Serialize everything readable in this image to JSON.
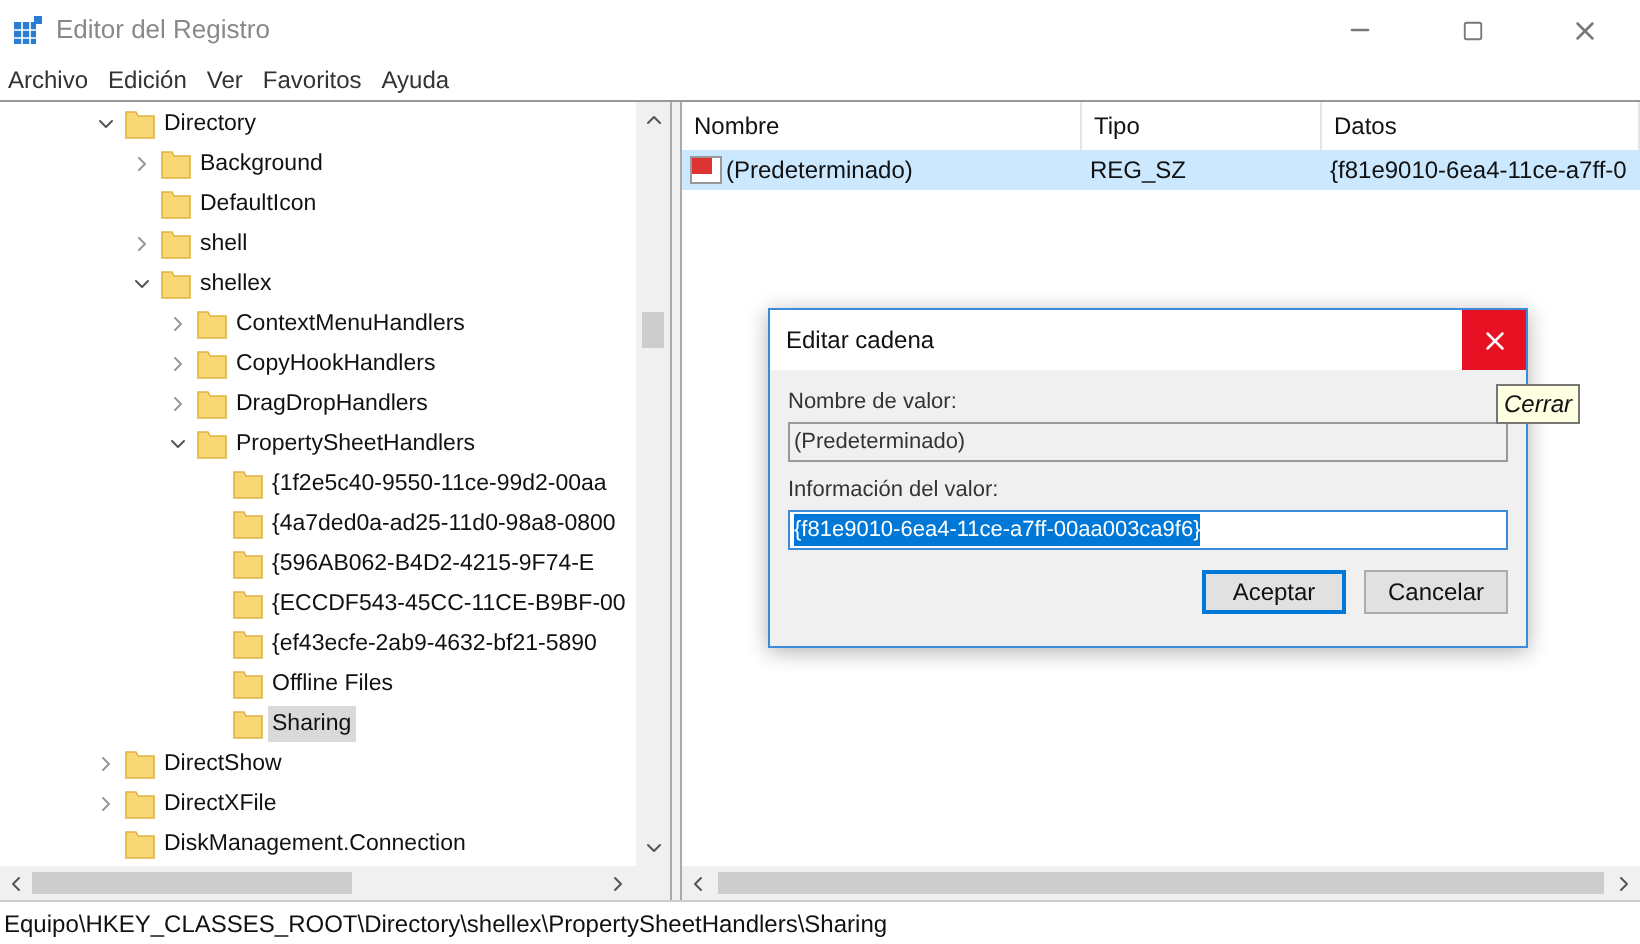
{
  "window": {
    "title": "Editor del Registro"
  },
  "menu": [
    "Archivo",
    "Edición",
    "Ver",
    "Favoritos",
    "Ayuda"
  ],
  "tree": [
    {
      "label": "Directory",
      "expanded": true,
      "selected": false,
      "children": [
        {
          "label": "Background",
          "expanded": false,
          "selected": false
        },
        {
          "label": "DefaultIcon",
          "selected": false
        },
        {
          "label": "shell",
          "expanded": false,
          "selected": false
        },
        {
          "label": "shellex",
          "expanded": true,
          "selected": false,
          "children": [
            {
              "label": "ContextMenuHandlers",
              "expanded": false,
              "selected": false
            },
            {
              "label": "CopyHookHandlers",
              "expanded": false,
              "selected": false
            },
            {
              "label": "DragDropHandlers",
              "expanded": false,
              "selected": false
            },
            {
              "label": "PropertySheetHandlers",
              "expanded": true,
              "selected": false,
              "children": [
                {
                  "label": "{1f2e5c40-9550-11ce-99d2-00aa",
                  "selected": false
                },
                {
                  "label": "{4a7ded0a-ad25-11d0-98a8-0800",
                  "selected": false
                },
                {
                  "label": "{596AB062-B4D2-4215-9F74-E",
                  "selected": false
                },
                {
                  "label": "{ECCDF543-45CC-11CE-B9BF-00",
                  "selected": false
                },
                {
                  "label": "{ef43ecfe-2ab9-4632-bf21-5890",
                  "selected": false
                },
                {
                  "label": "Offline Files",
                  "selected": false
                },
                {
                  "label": "Sharing",
                  "selected": true
                }
              ]
            }
          ]
        }
      ]
    },
    {
      "label": "DirectShow",
      "expanded": false,
      "selected": false
    },
    {
      "label": "DirectXFile",
      "expanded": false,
      "selected": false
    },
    {
      "label": "DiskManagement.Connection",
      "selected": false
    }
  ],
  "values_table": {
    "columns": [
      "Nombre",
      "Tipo",
      "Datos"
    ],
    "rows": [
      {
        "name": "(Predeterminado)",
        "type": "REG_SZ",
        "data": "{f81e9010-6ea4-11ce-a7ff-0",
        "selected": true
      }
    ]
  },
  "dialog": {
    "title": "Editar cadena",
    "name_label": "Nombre de valor:",
    "name_value": "(Predeterminado)",
    "data_label": "Información del valor:",
    "data_value": "{f81e9010-6ea4-11ce-a7ff-00aa003ca9f6}",
    "data_text_selected": true,
    "ok": "Aceptar",
    "cancel": "Cancelar",
    "close_hovered": true,
    "tooltip": "Cerrar"
  },
  "status_bar": "Equipo\\HKEY_CLASSES_ROOT\\Directory\\shellex\\PropertySheetHandlers\\Sharing"
}
